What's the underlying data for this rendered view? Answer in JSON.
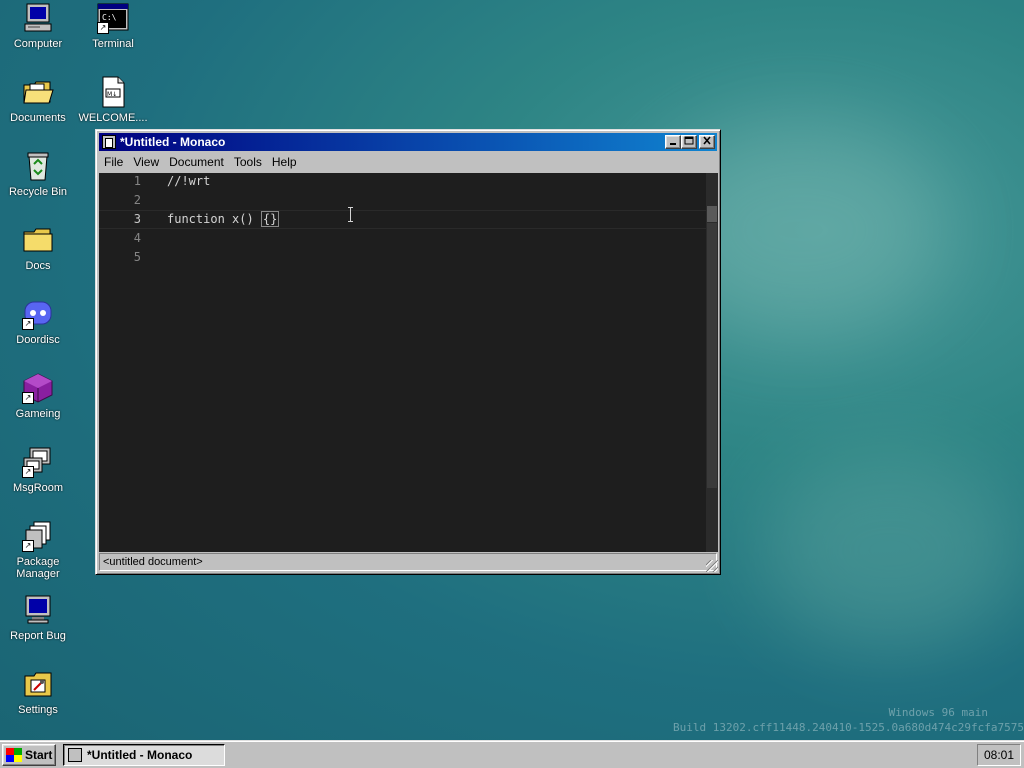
{
  "desktop": {
    "icons": [
      {
        "label": "Computer",
        "icon": "computer-icon"
      },
      {
        "label": "Terminal",
        "icon": "terminal-icon"
      },
      {
        "label": "Documents",
        "icon": "folder-open-icon"
      },
      {
        "label": "WELCOME....",
        "icon": "markdown-file-icon"
      },
      {
        "label": "Recycle Bin",
        "icon": "recycle-bin-icon"
      },
      {
        "label": "Docs",
        "icon": "folder-icon"
      },
      {
        "label": "Doordisc",
        "icon": "doordisc-icon"
      },
      {
        "label": "Gameing",
        "icon": "cube-icon"
      },
      {
        "label": "MsgRoom",
        "icon": "msgroom-icon"
      },
      {
        "label": "Package Manager",
        "icon": "package-icon"
      },
      {
        "label": "Report Bug",
        "icon": "monitor-icon"
      },
      {
        "label": "Settings",
        "icon": "settings-icon"
      }
    ],
    "watermark": {
      "line1": "Windows 96 main",
      "line2": "Build 13202.cff11448.240410-1525.0a680d474c29fcfa7575"
    }
  },
  "window": {
    "title": "*Untitled - Monaco",
    "menu": [
      "File",
      "View",
      "Document",
      "Tools",
      "Help"
    ],
    "editor": {
      "lines": [
        {
          "num": "1",
          "code": "//!wrt"
        },
        {
          "num": "2",
          "code": ""
        },
        {
          "num": "3",
          "code": "function x() ",
          "bracket": "{}"
        },
        {
          "num": "4",
          "code": ""
        },
        {
          "num": "5",
          "code": ""
        }
      ],
      "current_line": 3
    },
    "status": "<untitled document>"
  },
  "taskbar": {
    "start_label": "Start",
    "task_label": "*Untitled - Monaco",
    "clock": "08:01"
  },
  "colors": {
    "titlebar_start": "#000080",
    "titlebar_end": "#1084d0",
    "editor_bg": "#1e1e1e",
    "face": "#c0c0c0"
  }
}
